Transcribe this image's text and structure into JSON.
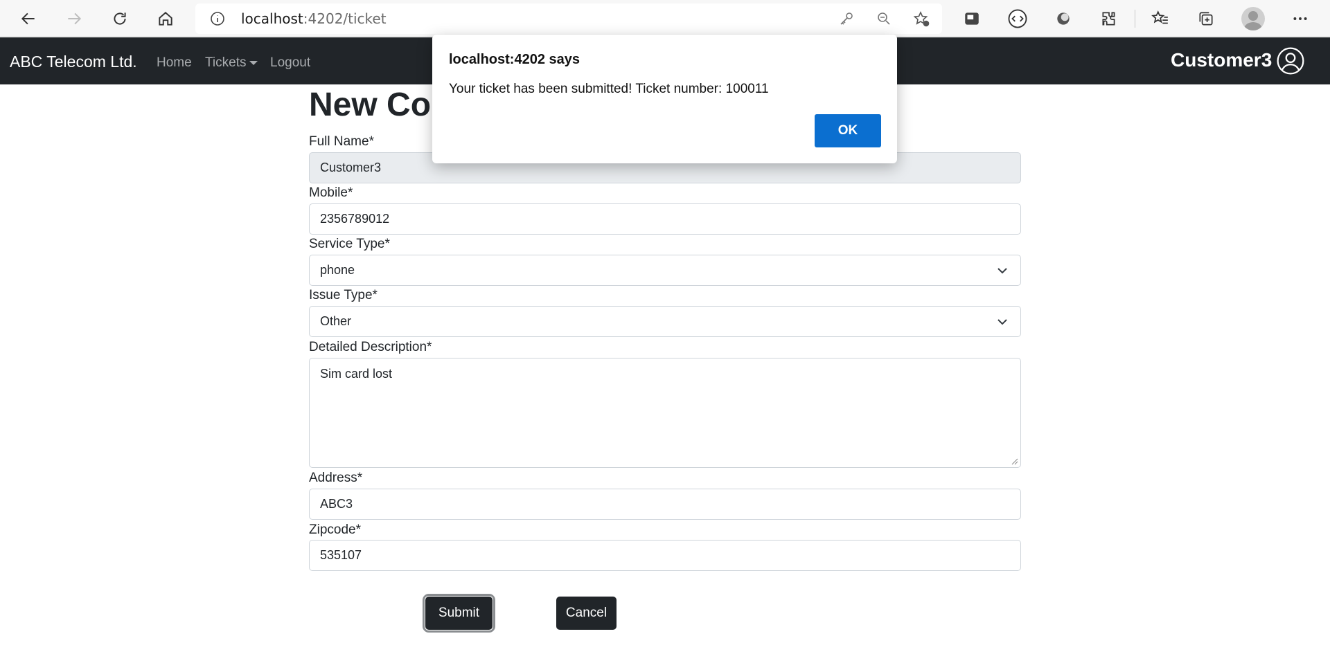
{
  "browser": {
    "url_host": "localhost",
    "url_path": ":4202/ticket",
    "accent_color": "#0b6fd0"
  },
  "navbar": {
    "brand": "ABC Telecom Ltd.",
    "links": [
      {
        "label": "Home"
      },
      {
        "label": "Tickets"
      },
      {
        "label": "Logout"
      }
    ],
    "user_name": "Customer3",
    "background": "#212529"
  },
  "form": {
    "title": "New Co",
    "fields": {
      "full_name": {
        "label": "Full Name*",
        "value": "Customer3"
      },
      "mobile": {
        "label": "Mobile*",
        "value": "2356789012"
      },
      "service_type": {
        "label": "Service Type*",
        "value": "phone"
      },
      "issue_type": {
        "label": "Issue Type*",
        "value": "Other"
      },
      "description": {
        "label": "Detailed Description*",
        "value": "Sim card lost"
      },
      "address": {
        "label": "Address*",
        "value": "ABC3"
      },
      "zipcode": {
        "label": "Zipcode*",
        "value": "535107"
      }
    },
    "submit_label": "Submit",
    "cancel_label": "Cancel"
  },
  "dialog": {
    "title": "localhost:4202 says",
    "message": "Your ticket has been submitted! Ticket number: 100011",
    "ok_label": "OK"
  }
}
